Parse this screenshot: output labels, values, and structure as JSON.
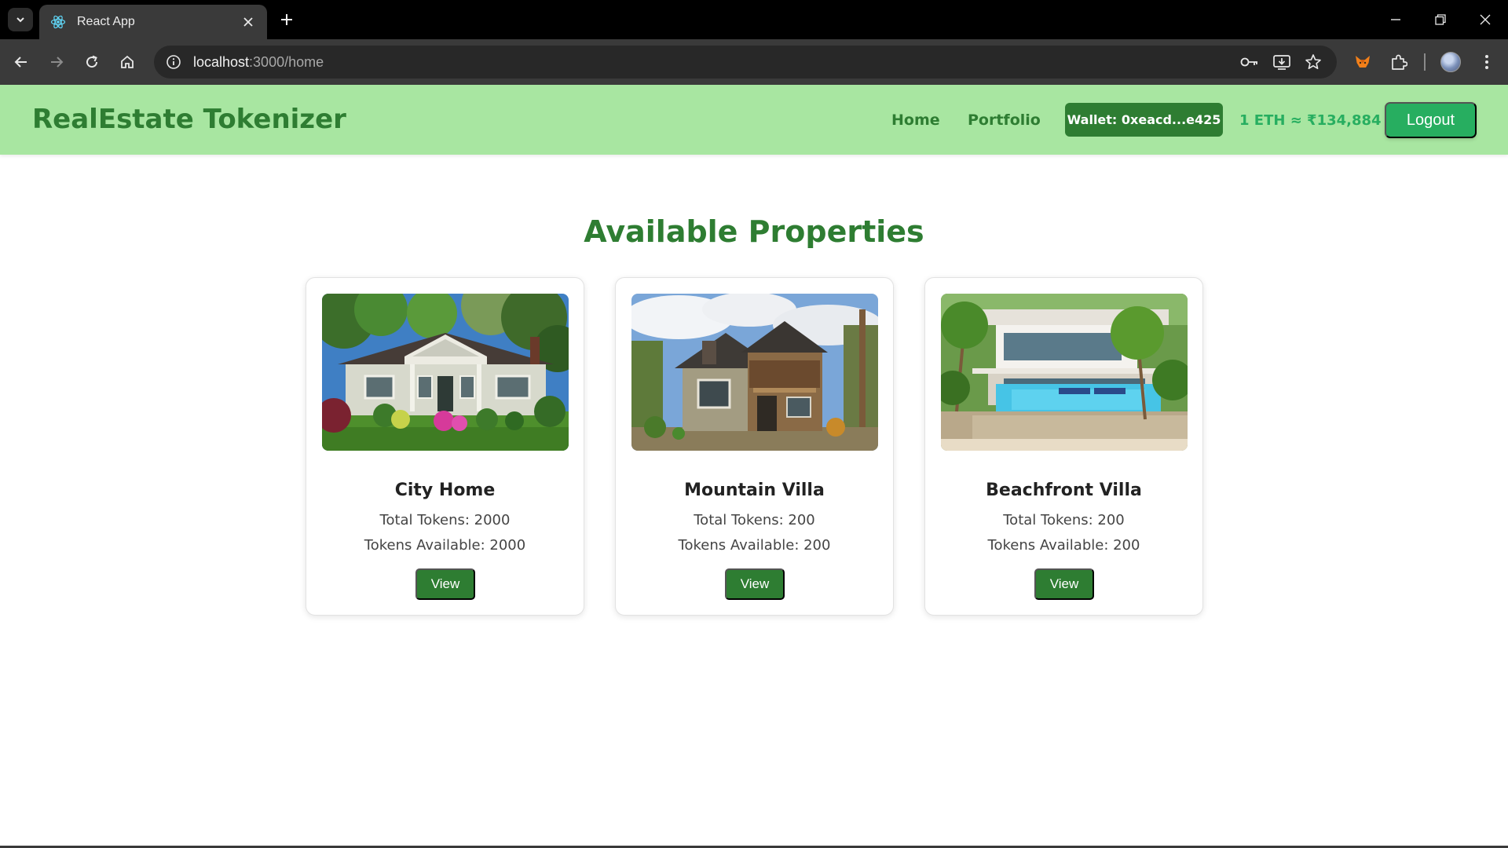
{
  "browser": {
    "tab_title": "React App",
    "url_host": "localhost",
    "url_path": ":3000/home",
    "icons": [
      "tab-search-icon",
      "react-logo-icon",
      "close-icon",
      "plus-icon",
      "minimize-icon",
      "restore-icon",
      "window-close-icon",
      "back-arrow-icon",
      "forward-arrow-icon",
      "reload-icon",
      "home-icon",
      "info-icon",
      "key-icon",
      "install-icon",
      "star-icon",
      "fox-extension-icon",
      "puzzle-icon",
      "kebab-menu-icon"
    ]
  },
  "header": {
    "brand": "RealEstate Tokenizer",
    "nav": [
      "Home",
      "Portfolio"
    ],
    "wallet": "Wallet: 0xeacd...e425",
    "eth_rate": "1 ETH ≈ ₹134,884",
    "logout": "Logout",
    "colors": {
      "background": "#a8e6a1",
      "primary": "#2e7d32",
      "accent": "#27ae60"
    }
  },
  "main": {
    "title": "Available Properties",
    "cards": [
      {
        "name": "City Home",
        "total": "Total Tokens: 2000",
        "available": "Tokens Available: 2000",
        "button": "View"
      },
      {
        "name": "Mountain Villa",
        "total": "Total Tokens: 200",
        "available": "Tokens Available: 200",
        "button": "View"
      },
      {
        "name": "Beachfront Villa",
        "total": "Total Tokens: 200",
        "available": "Tokens Available: 200",
        "button": "View"
      }
    ]
  }
}
